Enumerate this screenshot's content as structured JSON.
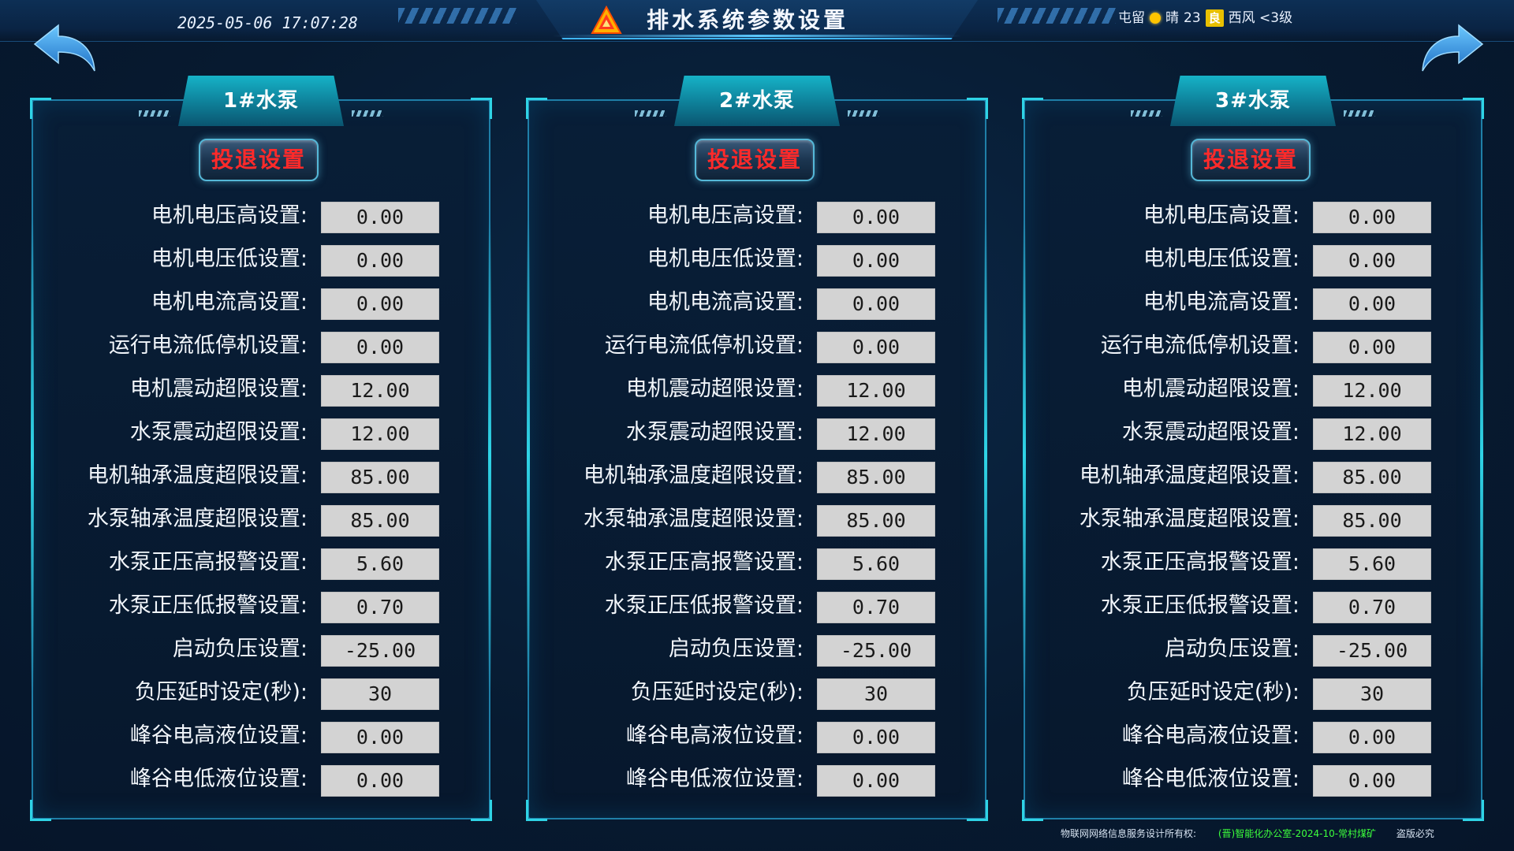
{
  "header": {
    "datetime": "2025-05-06 17:07:28",
    "title": "排水系统参数设置",
    "weather": {
      "location": "屯留",
      "condition": "晴",
      "temperature": "23",
      "aqi": "良",
      "wind": "西风 <3级"
    }
  },
  "panels": [
    {
      "title": "1#水泵",
      "toggle_label": "投退设置",
      "rows": [
        {
          "label": "电机电压高设置:",
          "value": "0.00"
        },
        {
          "label": "电机电压低设置:",
          "value": "0.00"
        },
        {
          "label": "电机电流高设置:",
          "value": "0.00"
        },
        {
          "label": "运行电流低停机设置:",
          "value": "0.00"
        },
        {
          "label": "电机震动超限设置:",
          "value": "12.00"
        },
        {
          "label": "水泵震动超限设置:",
          "value": "12.00"
        },
        {
          "label": "电机轴承温度超限设置:",
          "value": "85.00"
        },
        {
          "label": "水泵轴承温度超限设置:",
          "value": "85.00"
        },
        {
          "label": "水泵正压高报警设置:",
          "value": "5.60"
        },
        {
          "label": "水泵正压低报警设置:",
          "value": "0.70"
        },
        {
          "label": "启动负压设置:",
          "value": "-25.00"
        },
        {
          "label": "负压延时设定(秒):",
          "value": "30"
        },
        {
          "label": "峰谷电高液位设置:",
          "value": "0.00"
        },
        {
          "label": "峰谷电低液位设置:",
          "value": "0.00"
        }
      ]
    },
    {
      "title": "2#水泵",
      "toggle_label": "投退设置",
      "rows": [
        {
          "label": "电机电压高设置:",
          "value": "0.00"
        },
        {
          "label": "电机电压低设置:",
          "value": "0.00"
        },
        {
          "label": "电机电流高设置:",
          "value": "0.00"
        },
        {
          "label": "运行电流低停机设置:",
          "value": "0.00"
        },
        {
          "label": "电机震动超限设置:",
          "value": "12.00"
        },
        {
          "label": "水泵震动超限设置:",
          "value": "12.00"
        },
        {
          "label": "电机轴承温度超限设置:",
          "value": "85.00"
        },
        {
          "label": "水泵轴承温度超限设置:",
          "value": "85.00"
        },
        {
          "label": "水泵正压高报警设置:",
          "value": "5.60"
        },
        {
          "label": "水泵正压低报警设置:",
          "value": "0.70"
        },
        {
          "label": "启动负压设置:",
          "value": "-25.00"
        },
        {
          "label": "负压延时设定(秒):",
          "value": "30"
        },
        {
          "label": "峰谷电高液位设置:",
          "value": "0.00"
        },
        {
          "label": "峰谷电低液位设置:",
          "value": "0.00"
        }
      ]
    },
    {
      "title": "3#水泵",
      "toggle_label": "投退设置",
      "rows": [
        {
          "label": "电机电压高设置:",
          "value": "0.00"
        },
        {
          "label": "电机电压低设置:",
          "value": "0.00"
        },
        {
          "label": "电机电流高设置:",
          "value": "0.00"
        },
        {
          "label": "运行电流低停机设置:",
          "value": "0.00"
        },
        {
          "label": "电机震动超限设置:",
          "value": "12.00"
        },
        {
          "label": "水泵震动超限设置:",
          "value": "12.00"
        },
        {
          "label": "电机轴承温度超限设置:",
          "value": "85.00"
        },
        {
          "label": "水泵轴承温度超限设置:",
          "value": "85.00"
        },
        {
          "label": "水泵正压高报警设置:",
          "value": "5.60"
        },
        {
          "label": "水泵正压低报警设置:",
          "value": "0.70"
        },
        {
          "label": "启动负压设置:",
          "value": "-25.00"
        },
        {
          "label": "负压延时设定(秒):",
          "value": "30"
        },
        {
          "label": "峰谷电高液位设置:",
          "value": "0.00"
        },
        {
          "label": "峰谷电低液位设置:",
          "value": "0.00"
        }
      ]
    }
  ],
  "footer": {
    "copyright": "物联网网络信息服务设计所有权:",
    "project": "(晋)智能化办公室-2024-10-常村煤矿",
    "rights": "盗版必究"
  },
  "icons": {
    "logo": "triangle-logo-icon",
    "back": "back-arrow-icon",
    "forward": "forward-arrow-icon",
    "weather": "sun-icon"
  },
  "colors": {
    "background": "#071b31",
    "accent": "#2fd4e6",
    "toggle_text": "#ff2a2a",
    "input_bg": "#d3d3d3",
    "footer_highlight": "#3cff3c"
  }
}
